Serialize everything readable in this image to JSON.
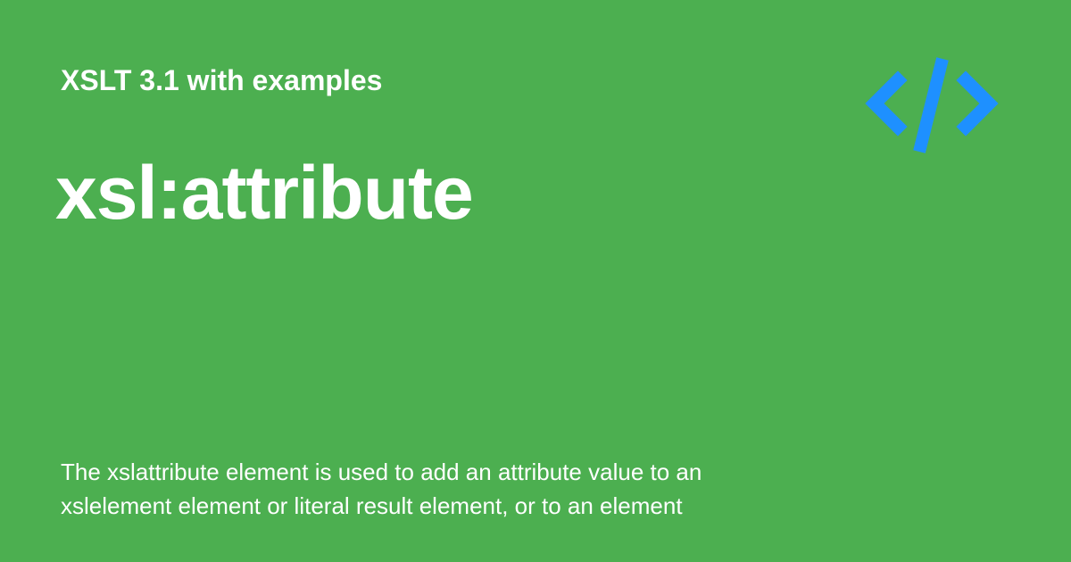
{
  "card": {
    "background_color": "#4caf50",
    "text_color": "#ffffff",
    "subtitle": "XSLT 3.1 with examples",
    "title": "xsl:attribute",
    "description_lines": [
      "The xslattribute element is used to add an attribute value to an",
      "xslelement element or literal result element, or to an element"
    ],
    "logo": {
      "icon": "code-brackets-icon",
      "color": "#1e90ff"
    }
  }
}
